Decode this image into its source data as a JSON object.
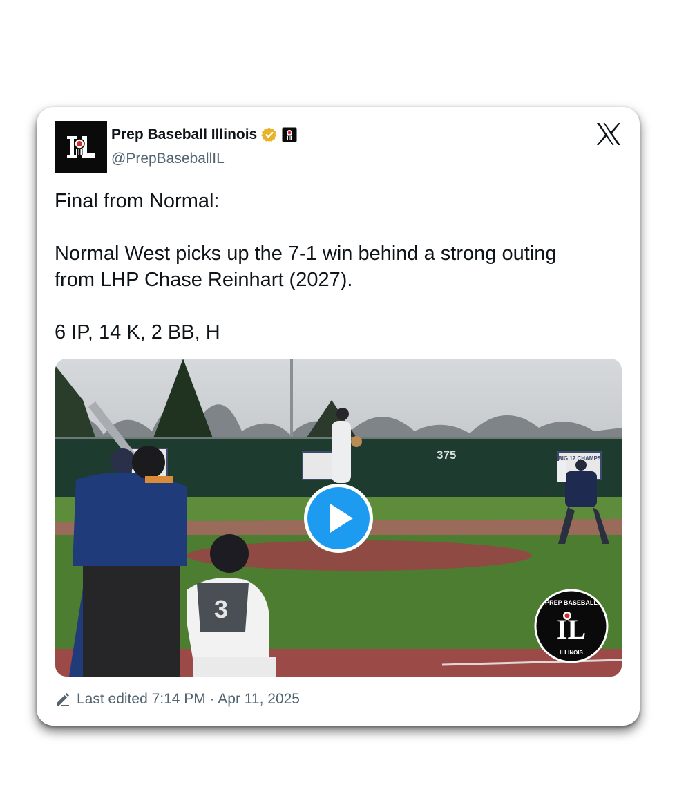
{
  "account": {
    "name": "Prep Baseball Illinois",
    "handle": "@PrepBaseballIL",
    "avatar_text": "IL",
    "verified_color": "#e8b22a"
  },
  "tweet": {
    "line1": "Final from Normal:",
    "line2a": "Normal West picks up the 7-1 win behind a strong outing",
    "line2b": "from LHP Chase Reinhart (2027).",
    "line3": "6 IP, 14 K, 2 BB, H"
  },
  "media": {
    "type": "video",
    "fence_number": "375",
    "banner_text": "BIG 12 CHAMPS",
    "watermark_top": "PREP BASEBALL",
    "watermark_mid": "IL",
    "watermark_bottom": "ILLINOIS",
    "play_color": "#1d9bf0"
  },
  "footer": {
    "edited_text": "Last edited 7:14 PM · Apr 11, 2025",
    "icon": "pencil-icon"
  },
  "icons": {
    "platform": "x-logo-icon",
    "verified": "verified-badge-icon",
    "affiliate": "affiliate-badge-icon",
    "play": "play-icon"
  }
}
